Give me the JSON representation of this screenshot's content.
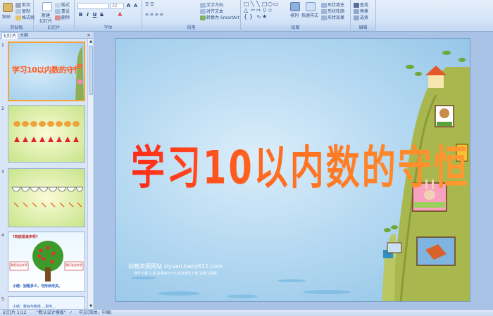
{
  "ribbon": {
    "clipboard": {
      "label": "剪贴板",
      "paste": "粘贴",
      "cut": "剪切",
      "copy": "复制",
      "format_painter": "格式刷"
    },
    "slides": {
      "label": "幻灯片",
      "new_slide": "新建",
      "new_slide_2": "幻灯片",
      "layout": "版式",
      "reset": "重设",
      "delete": "删除"
    },
    "font": {
      "label": "字体",
      "font_size": "32",
      "bold": "B",
      "italic": "I",
      "underline": "U"
    },
    "paragraph": {
      "label": "段落",
      "text_direction": "文字方向",
      "align_text": "对齐文本",
      "smartart": "转换为 SmartArt"
    },
    "drawing": {
      "label": "绘图",
      "arrange": "排列",
      "quick_styles": "快速样式",
      "shape_fill": "形状填充",
      "shape_outline": "形状轮廓",
      "shape_effects": "形状效果"
    },
    "editing": {
      "label": "编辑",
      "find": "查找",
      "replace": "替换",
      "select": "选择"
    }
  },
  "left_panel": {
    "tab_slides": "幻灯片",
    "tab_outline": "大纲",
    "close": "×",
    "thumbnails": [
      {
        "num": "1",
        "title": "学习10以内数的守恒"
      },
      {
        "num": "2"
      },
      {
        "num": "3"
      },
      {
        "num": "4",
        "heading": "?到底是谁多呀?",
        "caption": "小结：别看多少，与形状无关。",
        "left_bubble": "我是说这样多",
        "right_bubble": "我们说这样多"
      },
      {
        "num": "5",
        "partial": "小结：数目与物体 …别与…"
      }
    ]
  },
  "slide": {
    "title": "学习10以内数的守恒",
    "watermark": "幼教资源网站  ziyuan.baby611.com",
    "watermark_sub": "课件下载  儿歌  故事MP3  FLASH课件下载  试卷下载等"
  },
  "status_bar": {
    "slide_count": "幻灯片 1/12",
    "theme": "\"默认设计模板\"",
    "language": "中文(简体，中国)"
  },
  "colors": {
    "ribbon_bg": "#dbe7f8",
    "title_gradient_start": "#ff2a1a",
    "title_gradient_end": "#ff9a30",
    "sky": "#b7daf2",
    "selected_border": "#f4a43a"
  }
}
